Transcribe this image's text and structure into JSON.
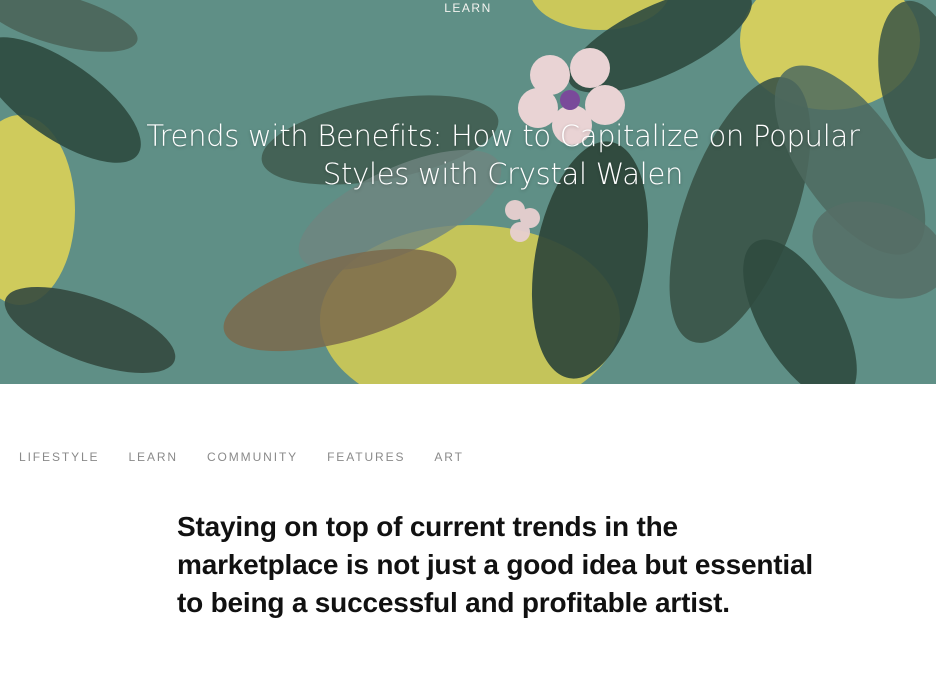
{
  "hero": {
    "category": "LEARN",
    "title": "Trends with Benefits: How to Capitalize on Popular Styles with Crystal Walen",
    "background_color": "#5f8f86"
  },
  "nav": {
    "items": [
      {
        "label": "LIFESTYLE"
      },
      {
        "label": "LEARN"
      },
      {
        "label": "COMMUNITY"
      },
      {
        "label": "FEATURES"
      },
      {
        "label": "ART"
      }
    ]
  },
  "article": {
    "lead": "Staying on top of current trends in the marketplace is not just a good idea but essential to being a successful and profitable artist."
  }
}
